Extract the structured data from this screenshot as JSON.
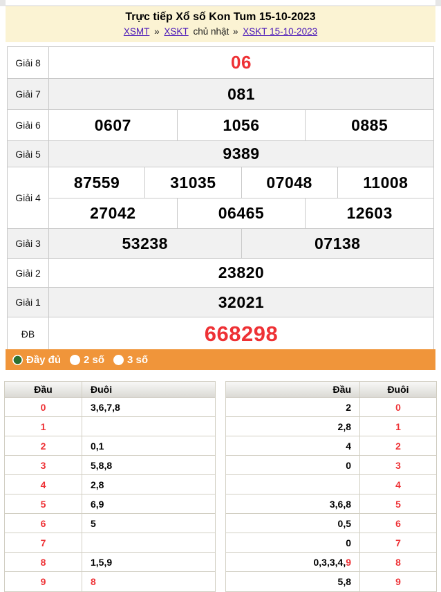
{
  "header": {
    "title": "Trực tiếp Xổ số Kon Tum 15-10-2023",
    "breadcrumb": {
      "link1": "XSMT",
      "sep1": "»",
      "link2": "XSKT",
      "text": "chủ nhật",
      "sep2": "»",
      "link3": "XSKT 15-10-2023"
    }
  },
  "prize_table": {
    "rows": [
      {
        "label": "Giải 8",
        "cells": [
          "06"
        ]
      },
      {
        "label": "Giải 7",
        "cells": [
          "081"
        ]
      },
      {
        "label": "Giải 6",
        "cells": [
          "0607",
          "1056",
          "0885"
        ]
      },
      {
        "label": "Giải 5",
        "cells": [
          "9389"
        ]
      },
      {
        "label": "Giải 4",
        "cells_row1": [
          "87559",
          "31035",
          "07048",
          "11008"
        ],
        "cells_row2": [
          "27042",
          "06465",
          "12603"
        ]
      },
      {
        "label": "Giải 3",
        "cells": [
          "53238",
          "07138"
        ]
      },
      {
        "label": "Giải 2",
        "cells": [
          "23820"
        ]
      },
      {
        "label": "Giải 1",
        "cells": [
          "32021"
        ]
      },
      {
        "label": "ĐB",
        "cells": [
          "668298"
        ]
      }
    ]
  },
  "filter_bar": {
    "options": [
      {
        "label": "Đầy đủ",
        "selected": true
      },
      {
        "label": "2 số",
        "selected": false
      },
      {
        "label": "3 số",
        "selected": false
      }
    ]
  },
  "head_tail_left": {
    "col_head": "Đầu",
    "col_tail": "Đuôi",
    "rows": [
      {
        "head": "0",
        "tails": "3,6,7,8",
        "tails_special": ""
      },
      {
        "head": "1",
        "tails": "",
        "tails_special": ""
      },
      {
        "head": "2",
        "tails": "0,1",
        "tails_special": ""
      },
      {
        "head": "3",
        "tails": "5,8,8",
        "tails_special": ""
      },
      {
        "head": "4",
        "tails": "2,8",
        "tails_special": ""
      },
      {
        "head": "5",
        "tails": "6,9",
        "tails_special": ""
      },
      {
        "head": "6",
        "tails": "5",
        "tails_special": ""
      },
      {
        "head": "7",
        "tails": "",
        "tails_special": ""
      },
      {
        "head": "8",
        "tails": "1,5,9",
        "tails_special": ""
      },
      {
        "head": "9",
        "tails": "",
        "tails_special": "8"
      }
    ]
  },
  "head_tail_right": {
    "col_head": "Đầu",
    "col_tail": "Đuôi",
    "rows": [
      {
        "heads": "2",
        "heads_special": "",
        "tail": "0"
      },
      {
        "heads": "2,8",
        "heads_special": "",
        "tail": "1"
      },
      {
        "heads": "4",
        "heads_special": "",
        "tail": "2"
      },
      {
        "heads": "0",
        "heads_special": "",
        "tail": "3"
      },
      {
        "heads": "",
        "heads_special": "",
        "tail": "4"
      },
      {
        "heads": "3,6,8",
        "heads_special": "",
        "tail": "5"
      },
      {
        "heads": "0,5",
        "heads_special": "",
        "tail": "6"
      },
      {
        "heads": "0",
        "heads_special": "",
        "tail": "7"
      },
      {
        "heads": "0,3,3,4,",
        "heads_special": "9",
        "tail": "8"
      },
      {
        "heads": "5,8",
        "heads_special": "",
        "tail": "9"
      }
    ]
  },
  "colors": {
    "highlight_red": "#ee3135",
    "accent_orange": "#f0953a",
    "selected_green": "#2d7030",
    "header_yellow": "#fbf3d3",
    "link_purple": "#4613b8"
  }
}
